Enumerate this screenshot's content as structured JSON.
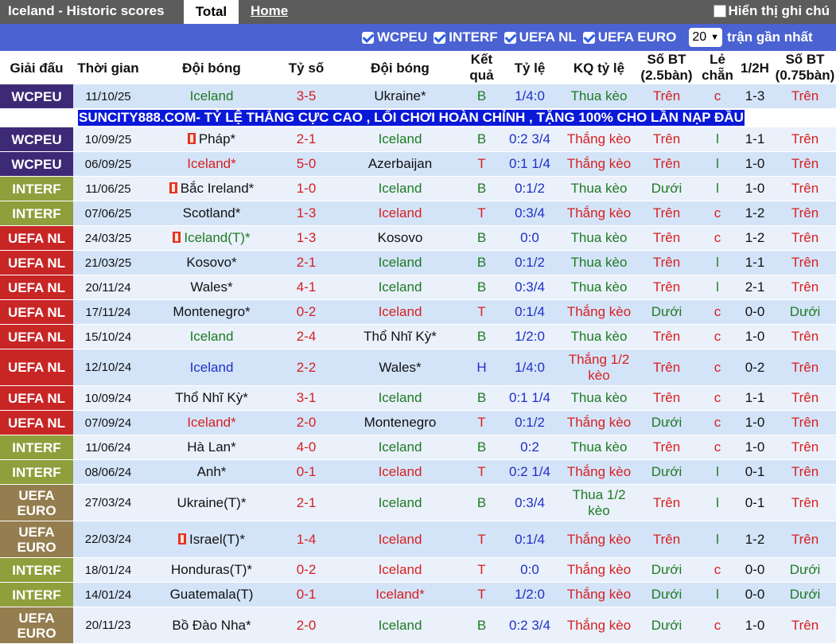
{
  "topbar": {
    "title": "Iceland - Historic scores",
    "tab_total": "Total",
    "tab_home": "Home",
    "option_label": "Hiển thị ghi chú"
  },
  "filters": {
    "items": [
      "WCPEU",
      "INTERF",
      "UEFA NL",
      "UEFA EURO"
    ],
    "count_value": "20",
    "count_label": "trận gần nhất"
  },
  "colors": {
    "WCPEU": "#3c2a76",
    "INTERF": "#8f9f3c",
    "UEFA NL": "#c82525",
    "UEFA EURO": "#947d4f",
    "ad_background": "#0a18d8"
  },
  "headers": [
    "Giải đấu",
    "Thời gian",
    "Đội bóng",
    "Tỷ số",
    "Đội bóng",
    "Kết quả",
    "Tỷ lệ",
    "KQ tỷ lệ",
    "Số BT (2.5bàn)",
    "Lẻ chẵn",
    "1/2H",
    "Số BT (0.75bàn)"
  ],
  "ad_text": "SUNCITY888.COM- TỶ LỆ THẮNG CỰC CAO , LỐI CHƠI HOÀN CHỈNH , TẶNG 100% CHO LẦN NẠP ĐẦU",
  "rows": [
    {
      "comp": "WCPEU",
      "ct": "wcpeu",
      "date": "11/10/25",
      "home": "Iceland",
      "hc": "grn",
      "hflag": false,
      "score": "3-5",
      "away": "Ukraine*",
      "ac": "blk",
      "aflag": false,
      "res": "B",
      "rate": "1/4:0",
      "kq": "Thua kèo",
      "kqc": "grn",
      "ou": "Trên",
      "ouc": "red",
      "oe": "c",
      "half": "1-3",
      "ou2": "Trên",
      "ou2c": "red"
    },
    {
      "comp": "WCPEU",
      "ct": "wcpeu",
      "date": "10/09/25",
      "home": "Pháp*",
      "hc": "blk",
      "hflag": true,
      "score": "2-1",
      "away": "Iceland",
      "ac": "grn",
      "aflag": false,
      "res": "B",
      "rate": "0:2 3/4",
      "kq": "Thắng kèo",
      "kqc": "red",
      "ou": "Trên",
      "ouc": "red",
      "oe": "l",
      "half": "1-1",
      "ou2": "Trên",
      "ou2c": "red"
    },
    {
      "comp": "WCPEU",
      "ct": "wcpeu",
      "date": "06/09/25",
      "home": "Iceland*",
      "hc": "red",
      "hflag": false,
      "score": "5-0",
      "away": "Azerbaijan",
      "ac": "blk",
      "aflag": false,
      "res": "T",
      "rate": "0:1 1/4",
      "kq": "Thắng kèo",
      "kqc": "red",
      "ou": "Trên",
      "ouc": "red",
      "oe": "l",
      "half": "1-0",
      "ou2": "Trên",
      "ou2c": "red"
    },
    {
      "comp": "INTERF",
      "ct": "interf",
      "date": "11/06/25",
      "home": "Bắc Ireland*",
      "hc": "blk",
      "hflag": true,
      "score": "1-0",
      "away": "Iceland",
      "ac": "grn",
      "aflag": false,
      "res": "B",
      "rate": "0:1/2",
      "kq": "Thua kèo",
      "kqc": "grn",
      "ou": "Dưới",
      "ouc": "grn",
      "oe": "l",
      "half": "1-0",
      "ou2": "Trên",
      "ou2c": "red"
    },
    {
      "comp": "INTERF",
      "ct": "interf",
      "date": "07/06/25",
      "home": "Scotland*",
      "hc": "blk",
      "hflag": false,
      "score": "1-3",
      "away": "Iceland",
      "ac": "red",
      "aflag": false,
      "res": "T",
      "rate": "0:3/4",
      "kq": "Thắng kèo",
      "kqc": "red",
      "ou": "Trên",
      "ouc": "red",
      "oe": "c",
      "half": "1-2",
      "ou2": "Trên",
      "ou2c": "red"
    },
    {
      "comp": "UEFA NL",
      "ct": "uefanl",
      "date": "24/03/25",
      "home": "Iceland(T)*",
      "hc": "grn",
      "hflag": true,
      "score": "1-3",
      "away": "Kosovo",
      "ac": "blk",
      "aflag": false,
      "res": "B",
      "rate": "0:0",
      "kq": "Thua kèo",
      "kqc": "grn",
      "ou": "Trên",
      "ouc": "red",
      "oe": "c",
      "half": "1-2",
      "ou2": "Trên",
      "ou2c": "red"
    },
    {
      "comp": "UEFA NL",
      "ct": "uefanl",
      "date": "21/03/25",
      "home": "Kosovo*",
      "hc": "blk",
      "hflag": false,
      "score": "2-1",
      "away": "Iceland",
      "ac": "grn",
      "aflag": false,
      "res": "B",
      "rate": "0:1/2",
      "kq": "Thua kèo",
      "kqc": "grn",
      "ou": "Trên",
      "ouc": "red",
      "oe": "l",
      "half": "1-1",
      "ou2": "Trên",
      "ou2c": "red"
    },
    {
      "comp": "UEFA NL",
      "ct": "uefanl",
      "date": "20/11/24",
      "home": "Wales*",
      "hc": "blk",
      "hflag": false,
      "score": "4-1",
      "away": "Iceland",
      "ac": "grn",
      "aflag": false,
      "res": "B",
      "rate": "0:3/4",
      "kq": "Thua kèo",
      "kqc": "grn",
      "ou": "Trên",
      "ouc": "red",
      "oe": "l",
      "half": "2-1",
      "ou2": "Trên",
      "ou2c": "red"
    },
    {
      "comp": "UEFA NL",
      "ct": "uefanl",
      "date": "17/11/24",
      "home": "Montenegro*",
      "hc": "blk",
      "hflag": false,
      "score": "0-2",
      "away": "Iceland",
      "ac": "red",
      "aflag": false,
      "res": "T",
      "rate": "0:1/4",
      "kq": "Thắng kèo",
      "kqc": "red",
      "ou": "Dưới",
      "ouc": "grn",
      "oe": "c",
      "half": "0-0",
      "ou2": "Dưới",
      "ou2c": "grn"
    },
    {
      "comp": "UEFA NL",
      "ct": "uefanl",
      "date": "15/10/24",
      "home": "Iceland",
      "hc": "grn",
      "hflag": false,
      "score": "2-4",
      "away": "Thổ Nhĩ Kỳ*",
      "ac": "blk",
      "aflag": false,
      "res": "B",
      "rate": "1/2:0",
      "kq": "Thua kèo",
      "kqc": "grn",
      "ou": "Trên",
      "ouc": "red",
      "oe": "c",
      "half": "1-0",
      "ou2": "Trên",
      "ou2c": "red"
    },
    {
      "comp": "UEFA NL",
      "ct": "uefanl",
      "date": "12/10/24",
      "home": "Iceland",
      "hc": "blu",
      "hflag": false,
      "score": "2-2",
      "away": "Wales*",
      "ac": "blk",
      "aflag": false,
      "res": "H",
      "rate": "1/4:0",
      "kq": "Thắng 1/2 kèo",
      "kqc": "red",
      "ou": "Trên",
      "ouc": "red",
      "oe": "c",
      "half": "0-2",
      "ou2": "Trên",
      "ou2c": "red",
      "tall": true
    },
    {
      "comp": "UEFA NL",
      "ct": "uefanl",
      "date": "10/09/24",
      "home": "Thổ Nhĩ Kỳ*",
      "hc": "blk",
      "hflag": false,
      "score": "3-1",
      "away": "Iceland",
      "ac": "grn",
      "aflag": false,
      "res": "B",
      "rate": "0:1 1/4",
      "kq": "Thua kèo",
      "kqc": "grn",
      "ou": "Trên",
      "ouc": "red",
      "oe": "c",
      "half": "1-1",
      "ou2": "Trên",
      "ou2c": "red"
    },
    {
      "comp": "UEFA NL",
      "ct": "uefanl",
      "date": "07/09/24",
      "home": "Iceland*",
      "hc": "red",
      "hflag": false,
      "score": "2-0",
      "away": "Montenegro",
      "ac": "blk",
      "aflag": false,
      "res": "T",
      "rate": "0:1/2",
      "kq": "Thắng kèo",
      "kqc": "red",
      "ou": "Dưới",
      "ouc": "grn",
      "oe": "c",
      "half": "1-0",
      "ou2": "Trên",
      "ou2c": "red"
    },
    {
      "comp": "INTERF",
      "ct": "interf",
      "date": "11/06/24",
      "home": "Hà Lan*",
      "hc": "blk",
      "hflag": false,
      "score": "4-0",
      "away": "Iceland",
      "ac": "grn",
      "aflag": false,
      "res": "B",
      "rate": "0:2",
      "kq": "Thua kèo",
      "kqc": "grn",
      "ou": "Trên",
      "ouc": "red",
      "oe": "c",
      "half": "1-0",
      "ou2": "Trên",
      "ou2c": "red"
    },
    {
      "comp": "INTERF",
      "ct": "interf",
      "date": "08/06/24",
      "home": "Anh*",
      "hc": "blk",
      "hflag": false,
      "score": "0-1",
      "away": "Iceland",
      "ac": "red",
      "aflag": false,
      "res": "T",
      "rate": "0:2 1/4",
      "kq": "Thắng kèo",
      "kqc": "red",
      "ou": "Dưới",
      "ouc": "grn",
      "oe": "l",
      "half": "0-1",
      "ou2": "Trên",
      "ou2c": "red"
    },
    {
      "comp": "UEFA EURO",
      "ct": "uefaeuro",
      "date": "27/03/24",
      "home": "Ukraine(T)*",
      "hc": "blk",
      "hflag": false,
      "score": "2-1",
      "away": "Iceland",
      "ac": "grn",
      "aflag": false,
      "res": "B",
      "rate": "0:3/4",
      "kq": "Thua 1/2 kèo",
      "kqc": "grn",
      "ou": "Trên",
      "ouc": "red",
      "oe": "l",
      "half": "0-1",
      "ou2": "Trên",
      "ou2c": "red",
      "tall": true
    },
    {
      "comp": "UEFA EURO",
      "ct": "uefaeuro",
      "date": "22/03/24",
      "home": "Israel(T)*",
      "hc": "blk",
      "hflag": true,
      "score": "1-4",
      "away": "Iceland",
      "ac": "red",
      "aflag": false,
      "res": "T",
      "rate": "0:1/4",
      "kq": "Thắng kèo",
      "kqc": "red",
      "ou": "Trên",
      "ouc": "red",
      "oe": "l",
      "half": "1-2",
      "ou2": "Trên",
      "ou2c": "red",
      "tall": true
    },
    {
      "comp": "INTERF",
      "ct": "interf",
      "date": "18/01/24",
      "home": "Honduras(T)*",
      "hc": "blk",
      "hflag": false,
      "score": "0-2",
      "away": "Iceland",
      "ac": "red",
      "aflag": false,
      "res": "T",
      "rate": "0:0",
      "kq": "Thắng kèo",
      "kqc": "red",
      "ou": "Dưới",
      "ouc": "grn",
      "oe": "c",
      "half": "0-0",
      "ou2": "Dưới",
      "ou2c": "grn"
    },
    {
      "comp": "INTERF",
      "ct": "interf",
      "date": "14/01/24",
      "home": "Guatemala(T)",
      "hc": "blk",
      "hflag": false,
      "score": "0-1",
      "away": "Iceland*",
      "ac": "red",
      "aflag": false,
      "res": "T",
      "rate": "1/2:0",
      "kq": "Thắng kèo",
      "kqc": "red",
      "ou": "Dưới",
      "ouc": "grn",
      "oe": "l",
      "half": "0-0",
      "ou2": "Dưới",
      "ou2c": "grn"
    },
    {
      "comp": "UEFA EURO",
      "ct": "uefaeuro",
      "date": "20/11/23",
      "home": "Bồ Đào Nha*",
      "hc": "blk",
      "hflag": false,
      "score": "2-0",
      "away": "Iceland",
      "ac": "grn",
      "aflag": false,
      "res": "B",
      "rate": "0:2 3/4",
      "kq": "Thắng kèo",
      "kqc": "red",
      "ou": "Dưới",
      "ouc": "grn",
      "oe": "c",
      "half": "1-0",
      "ou2": "Trên",
      "ou2c": "red",
      "tall": true
    }
  ]
}
